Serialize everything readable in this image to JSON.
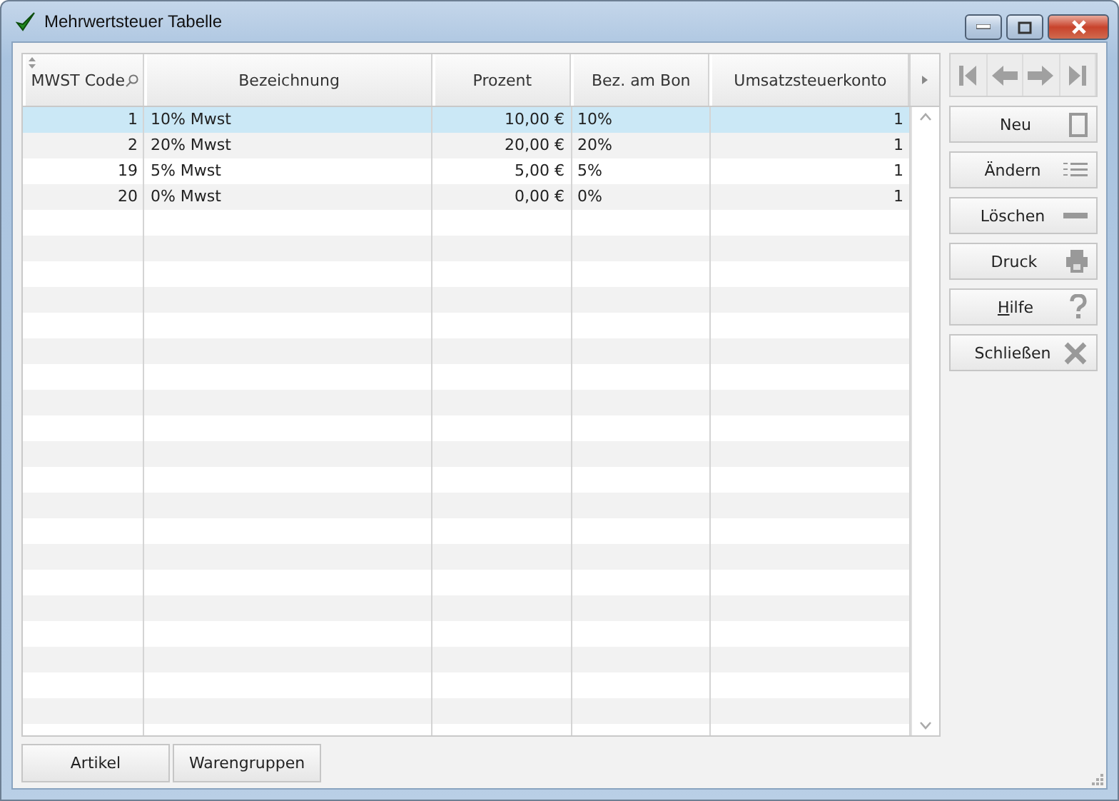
{
  "window": {
    "title": "Mehrwertsteuer Tabelle"
  },
  "table": {
    "columns": [
      {
        "label": "MWST Code",
        "sortable": true
      },
      {
        "label": "Bezeichnung",
        "sortable": false
      },
      {
        "label": "Prozent",
        "sortable": false
      },
      {
        "label": "Bez. am Bon",
        "sortable": false
      },
      {
        "label": "Umsatzsteuerkonto",
        "sortable": false
      }
    ],
    "rows": [
      {
        "selected": true,
        "cells": [
          "1",
          "10% Mwst",
          "10,00 €",
          "10%",
          "1"
        ]
      },
      {
        "selected": false,
        "cells": [
          "2",
          "20% Mwst",
          "20,00 €",
          "20%",
          "1"
        ]
      },
      {
        "selected": false,
        "cells": [
          "19",
          "5% Mwst",
          "5,00 €",
          "5%",
          "1"
        ]
      },
      {
        "selected": false,
        "cells": [
          "20",
          "0% Mwst",
          "0,00 €",
          "0%",
          "1"
        ]
      }
    ]
  },
  "navigation": [
    {
      "kind": "first",
      "disabled": true
    },
    {
      "kind": "prev",
      "disabled": true
    },
    {
      "kind": "next",
      "disabled": true
    },
    {
      "kind": "last",
      "disabled": true
    }
  ],
  "actions": [
    {
      "label": "Neu",
      "kind": "new",
      "mnemonic": false
    },
    {
      "label": "Ändern",
      "kind": "edit",
      "mnemonic": false
    },
    {
      "label": "Löschen",
      "kind": "delete",
      "mnemonic": false
    },
    {
      "label": "Druck",
      "kind": "print",
      "mnemonic": false
    },
    {
      "label": "Hilfe",
      "kind": "help",
      "mnemonic": true
    },
    {
      "label": "Schließen",
      "kind": "close",
      "mnemonic": false
    }
  ],
  "bottom_buttons": [
    "Artikel",
    "Warengruppen"
  ]
}
